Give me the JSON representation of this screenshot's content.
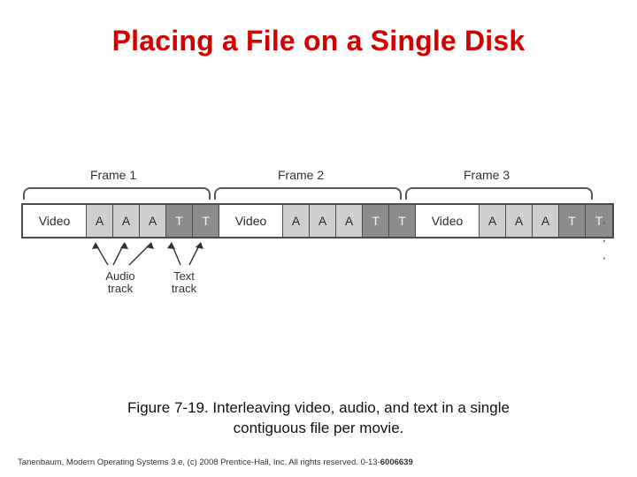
{
  "slide": {
    "title": "Placing a File on a Single Disk",
    "title_color": "#d40000"
  },
  "figure": {
    "frame_labels": [
      "Frame 1",
      "Frame 2",
      "Frame 3"
    ],
    "ellipsis": "· · ·",
    "cells": [
      {
        "label": "Video",
        "kind": "video"
      },
      {
        "label": "A",
        "kind": "audio"
      },
      {
        "label": "A",
        "kind": "audio"
      },
      {
        "label": "A",
        "kind": "audio"
      },
      {
        "label": "T",
        "kind": "text"
      },
      {
        "label": "T",
        "kind": "text"
      },
      {
        "label": "Video",
        "kind": "video"
      },
      {
        "label": "A",
        "kind": "audio"
      },
      {
        "label": "A",
        "kind": "audio"
      },
      {
        "label": "A",
        "kind": "audio"
      },
      {
        "label": "T",
        "kind": "text"
      },
      {
        "label": "T",
        "kind": "text"
      },
      {
        "label": "Video",
        "kind": "video"
      },
      {
        "label": "A",
        "kind": "audio"
      },
      {
        "label": "A",
        "kind": "audio"
      },
      {
        "label": "A",
        "kind": "audio"
      },
      {
        "label": "T",
        "kind": "text"
      },
      {
        "label": "T",
        "kind": "text"
      }
    ],
    "callouts": [
      {
        "line1": "Audio",
        "line2": "track"
      },
      {
        "line1": "Text",
        "line2": "track"
      }
    ],
    "colors": {
      "video_fill": "#ffffff",
      "audio_fill": "#cfcfcf",
      "text_fill": "#8c8c8c",
      "stroke": "#4c4c4c"
    }
  },
  "caption": {
    "line1": "Figure 7-19. Interleaving video, audio, and text in a single",
    "line2": "contiguous file per movie."
  },
  "credit": {
    "text": "Tanenbaum, Modern Operating Systems 3 e, (c) 2008 Prentice-Hall, Inc. All rights reserved. 0-13-",
    "isbn": "6006639"
  }
}
